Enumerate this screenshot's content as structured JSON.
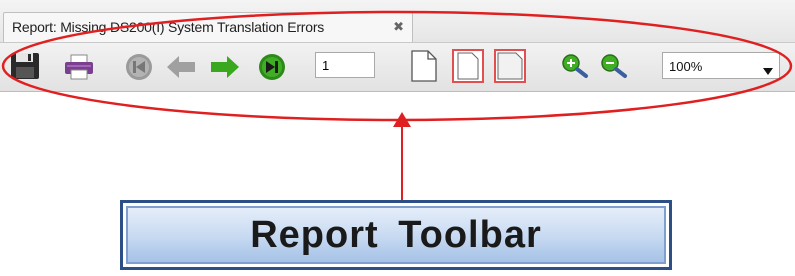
{
  "tab": {
    "title": "Report: Missing DS200(I) System Translation Errors",
    "close_icon": "close-icon"
  },
  "toolbar": {
    "buttons": [
      {
        "name": "save-icon"
      },
      {
        "name": "print-icon"
      },
      {
        "name": "first-page-icon"
      },
      {
        "name": "previous-page-icon"
      },
      {
        "name": "next-page-icon"
      },
      {
        "name": "last-page-icon"
      },
      {
        "name": "single-page-icon"
      },
      {
        "name": "fit-page-icon"
      },
      {
        "name": "fit-width-icon"
      },
      {
        "name": "zoom-in-icon"
      },
      {
        "name": "zoom-out-icon"
      }
    ],
    "page_number": "1",
    "zoom": "100%"
  },
  "annotation": {
    "label": "Report  Toolbar",
    "color": "#e02020",
    "box_border": "#2c4f86"
  }
}
